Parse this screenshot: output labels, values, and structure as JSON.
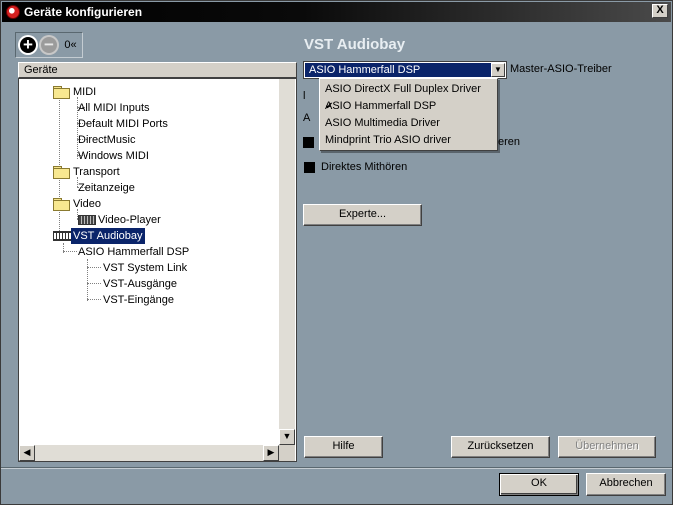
{
  "window": {
    "title": "Geräte konfigurieren",
    "close_glyph": "X"
  },
  "toolbar": {
    "add_glyph": "+",
    "remove_glyph": "−",
    "reset_label": "0«"
  },
  "tree": {
    "header": "Geräte",
    "items": [
      {
        "label": "MIDI"
      },
      {
        "label": "All MIDI Inputs"
      },
      {
        "label": "Default MIDI Ports"
      },
      {
        "label": "DirectMusic"
      },
      {
        "label": "Windows MIDI"
      },
      {
        "label": "Transport"
      },
      {
        "label": "Zeitanzeige"
      },
      {
        "label": "Video"
      },
      {
        "label": "Video-Player"
      },
      {
        "label": "VST Audiobay"
      },
      {
        "label": "ASIO Hammerfall DSP"
      },
      {
        "label": "VST System Link"
      },
      {
        "label": "VST-Ausgänge"
      },
      {
        "label": "VST-Eingänge"
      }
    ]
  },
  "scrollbar": {
    "up": "▲",
    "down": "▼",
    "left": "◀",
    "right": "▶"
  },
  "panel": {
    "title": "VST Audiobay",
    "driver_combo": {
      "value": "ASIO Hammerfall DSP",
      "label": "Master-ASIO-Treiber",
      "arrow": "▼"
    },
    "driver_options": [
      {
        "label": "ASIO DirectX Full Duplex Driver",
        "checked": false
      },
      {
        "label": "ASIO Hammerfall DSP",
        "checked": true
      },
      {
        "label": "ASIO Multimedia Driver",
        "checked": false
      },
      {
        "label": "Mindprint Trio ASIO driver",
        "checked": false
      }
    ],
    "check_glyph": "✔",
    "partial_text": {
      "a": "l",
      "b": "A",
      "c": "eren"
    },
    "direct_monitoring": {
      "label": "Direktes Mithören",
      "checked": true
    },
    "expert_button": "Experte..."
  },
  "buttons": {
    "help": "Hilfe",
    "reset": "Zurücksetzen",
    "apply": "Übernehmen",
    "ok": "OK",
    "cancel": "Abbrechen"
  }
}
